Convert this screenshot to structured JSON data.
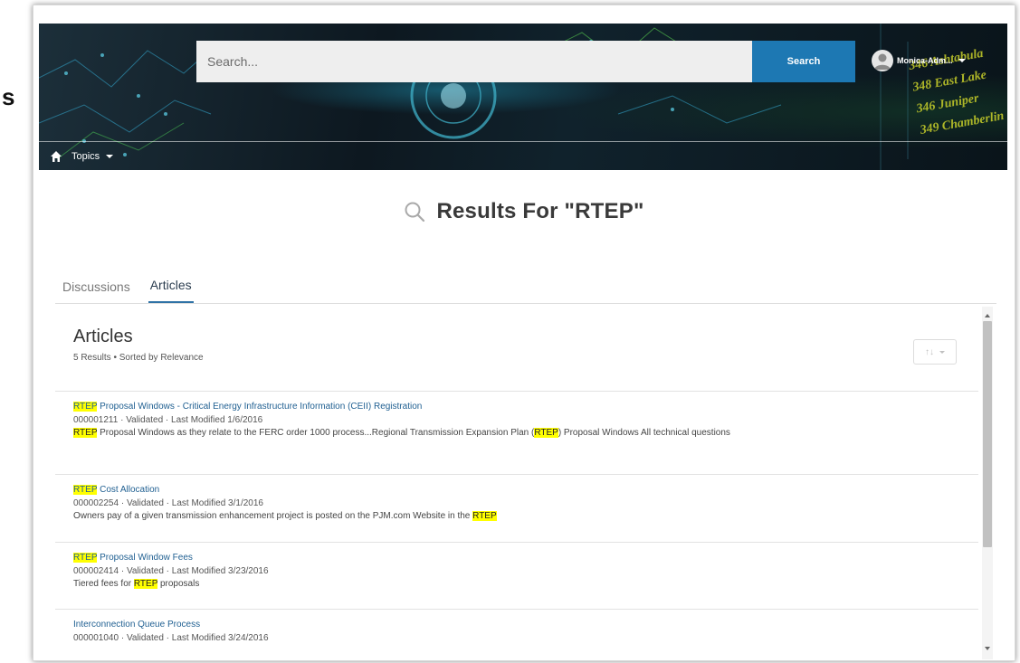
{
  "stray_char": "s",
  "header": {
    "search_placeholder": "Search...",
    "search_button": "Search",
    "profile_name": "Monica-Adm...",
    "nav_topics": "Topics",
    "ticker_lines": [
      "346 Ashtabula",
      "348 East Lake",
      "346 Juniper",
      "349 Chamberlin"
    ]
  },
  "results": {
    "heading": "Results For \"RTEP\""
  },
  "tabs": [
    {
      "label": "Discussions",
      "active": false
    },
    {
      "label": "Articles",
      "active": true
    }
  ],
  "panel": {
    "title": "Articles",
    "summary": "5 Results • Sorted by Relevance",
    "sort_icon_text": "↑↓"
  },
  "articles": [
    {
      "title_highlight": "RTEP",
      "title_rest": " Proposal Windows - Critical Energy Infrastructure Information (CEII) Registration",
      "meta": "000001211  ·  Validated  ·  Last Modified  1/6/2016",
      "snippet_parts": [
        {
          "text": "RTEP",
          "hl": true
        },
        {
          "text": " Proposal Windows as they relate to the FERC order 1000 process...Regional Transmission Expansion Plan (",
          "hl": false
        },
        {
          "text": "RTEP",
          "hl": true
        },
        {
          "text": ") Proposal Windows All technical questions",
          "hl": false
        }
      ]
    },
    {
      "title_highlight": "RTEP",
      "title_rest": " Cost Allocation",
      "meta": "000002254  ·  Validated  ·  Last Modified  3/1/2016",
      "snippet_parts": [
        {
          "text": "Owners pay of a given transmission enhancement project is posted on the PJM.com Website in the ",
          "hl": false
        },
        {
          "text": "RTEP",
          "hl": true
        }
      ]
    },
    {
      "title_highlight": "RTEP",
      "title_rest": " Proposal Window Fees",
      "meta": "000002414  ·  Validated  ·  Last Modified  3/23/2016",
      "snippet_parts": [
        {
          "text": "Tiered fees for ",
          "hl": false
        },
        {
          "text": "RTEP",
          "hl": true
        },
        {
          "text": " proposals",
          "hl": false
        }
      ]
    },
    {
      "title_highlight": "",
      "title_rest": "Interconnection Queue Process",
      "meta": "000001040  ·  Validated  ·  Last Modified  3/24/2016",
      "snippet_parts": []
    }
  ],
  "colors": {
    "search_button": "#1d78b3",
    "highlight": "#ffff00",
    "link": "#1f5f91",
    "active_tab_underline": "#2f73a6"
  },
  "icons": [
    "home-icon",
    "search-magnifier-icon",
    "avatar-icon",
    "sort-icon",
    "chevron-down-icon"
  ]
}
